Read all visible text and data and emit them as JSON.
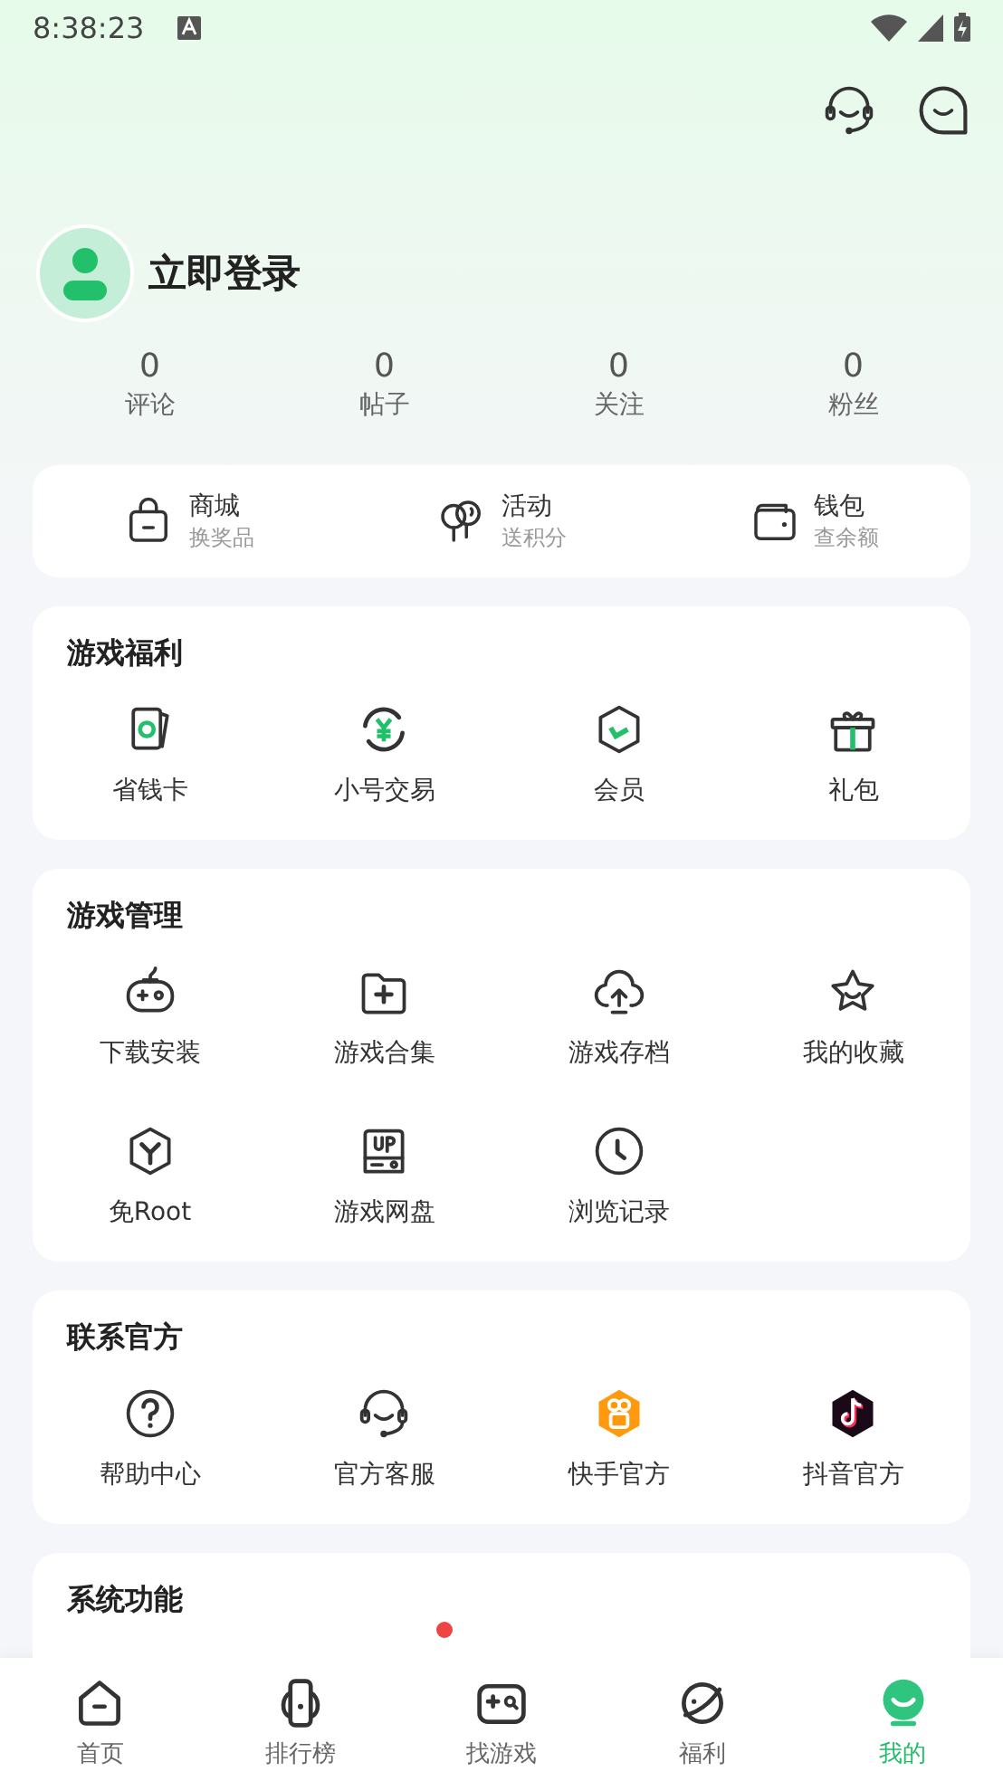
{
  "status_bar": {
    "time": "8:38:23"
  },
  "profile": {
    "login_label": "立即登录"
  },
  "stats": [
    {
      "value": "0",
      "label": "评论"
    },
    {
      "value": "0",
      "label": "帖子"
    },
    {
      "value": "0",
      "label": "关注"
    },
    {
      "value": "0",
      "label": "粉丝"
    }
  ],
  "quick_links": [
    {
      "title": "商城",
      "subtitle": "换奖品"
    },
    {
      "title": "活动",
      "subtitle": "送积分"
    },
    {
      "title": "钱包",
      "subtitle": "查余额"
    }
  ],
  "sections": [
    {
      "title": "游戏福利",
      "items": [
        "省钱卡",
        "小号交易",
        "会员",
        "礼包"
      ]
    },
    {
      "title": "游戏管理",
      "items": [
        "下载安装",
        "游戏合集",
        "游戏存档",
        "我的收藏",
        "免Root",
        "游戏网盘",
        "浏览记录"
      ]
    },
    {
      "title": "联系官方",
      "items": [
        "帮助中心",
        "官方客服",
        "快手官方",
        "抖音官方"
      ]
    },
    {
      "title": "系统功能"
    }
  ],
  "bottom_nav": [
    {
      "label": "首页",
      "selected": false
    },
    {
      "label": "排行榜",
      "selected": false
    },
    {
      "label": "找游戏",
      "selected": false
    },
    {
      "label": "福利",
      "selected": false
    },
    {
      "label": "我的",
      "selected": true
    }
  ]
}
